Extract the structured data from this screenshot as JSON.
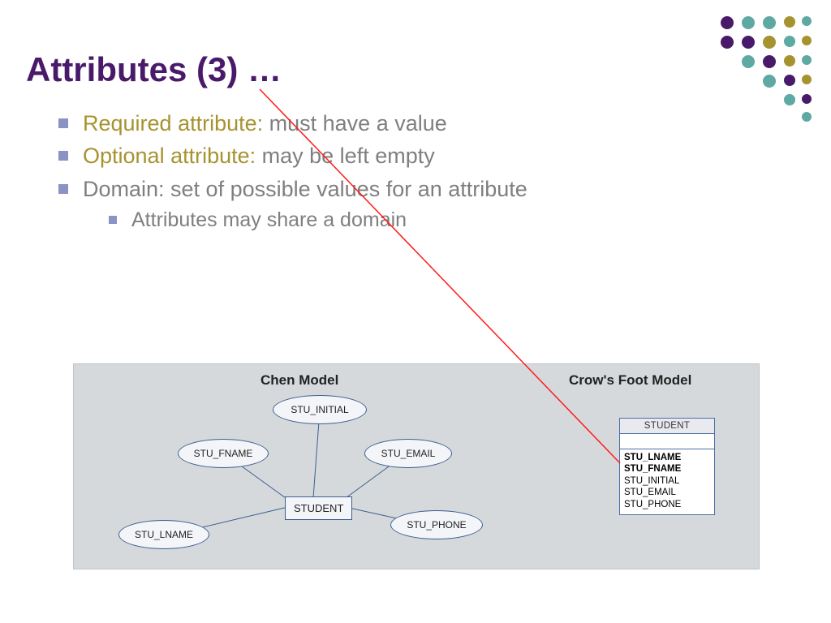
{
  "title": "Attributes (3) …",
  "bullets": {
    "b1_label": "Required attribute:",
    "b1_text": " must have a value",
    "b2_label": "Optional attribute:",
    "b2_text": " may be left empty",
    "b3": "Domain: set of possible values for an attribute",
    "b3_sub": "Attributes may share a domain"
  },
  "chen": {
    "title": "Chen Model",
    "entity": "STUDENT",
    "attrs": {
      "lname": "STU_LNAME",
      "fname": "STU_FNAME",
      "initial": "STU_INITIAL",
      "email": "STU_EMAIL",
      "phone": "STU_PHONE"
    }
  },
  "crow": {
    "title": "Crow's Foot Model",
    "header": "STUDENT",
    "rows": {
      "r1": "STU_LNAME",
      "r2": "STU_FNAME",
      "r3": "STU_INITIAL",
      "r4": "STU_EMAIL",
      "r5": "STU_PHONE"
    }
  }
}
